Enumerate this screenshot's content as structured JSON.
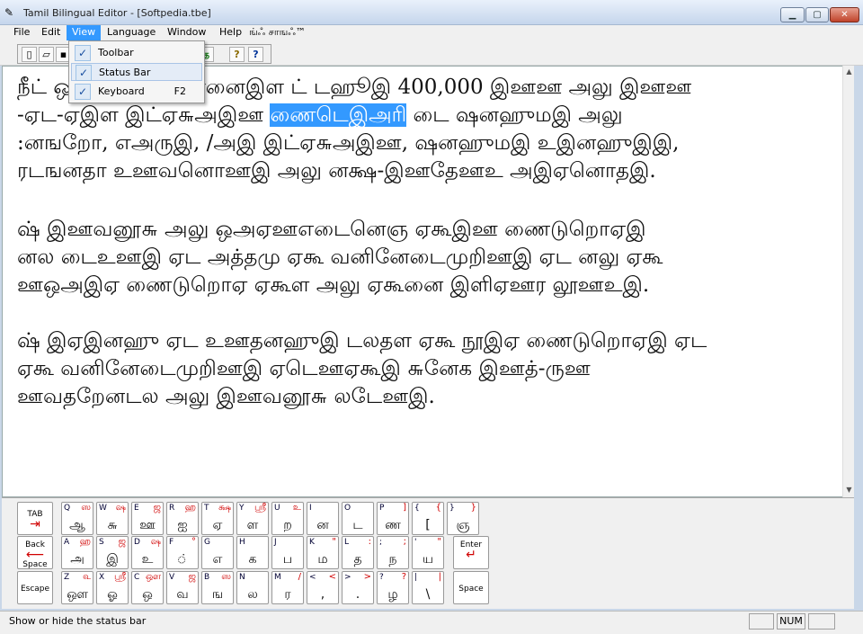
{
  "window": {
    "title": "Tamil Bilingual Editor - [Softpedia.tbe]",
    "app_icon": "pen-icon"
  },
  "menubar": [
    "File",
    "Edit",
    "View",
    "Language",
    "Window",
    "Help",
    "ங்ஃ சாஙஃ™"
  ],
  "toolbar": {
    "buttons": [
      "new-icon",
      "open-icon",
      "save-icon",
      "cut-icon",
      "copy-icon",
      "paste-icon",
      "print-icon",
      "tamil-icon",
      "help-icon",
      "context-help-icon"
    ],
    "tamil_label": "த",
    "help_label": "?",
    "context_help_label": "?"
  },
  "view_menu": {
    "items": [
      {
        "label": "Toolbar",
        "checked": true,
        "shortcut": ""
      },
      {
        "label": "Status Bar",
        "checked": true,
        "shortcut": ""
      },
      {
        "label": "Keyboard",
        "checked": true,
        "shortcut": "F2"
      }
    ]
  },
  "editor": {
    "p1": {
      "line1": "நீட் ஒ ஆ ஊ அ தனனைஇள ட் டஹூஇ 400,000 இஊஊ அலு இஊஊ",
      "line2_pre": "-ஏட-ஏஇள இட்ஏ௬அஇஊ ",
      "line2_sel": "ணைடெஇஅரி",
      "line2_post": " டை ஷனஹுமஇ அலு",
      "line3": ":னஙறோ, எஅருஇ, /அஇ இட்ஏ௬அஇஊ, ஷனஹுமஇ உஇனஹுஇஇ,",
      "line4": "ரடஙனதா உஊவனொஊஇ அலு னக்ஷ-இஊதேஊஉ அஇஏனொதஇ."
    },
    "p2": {
      "line1": "ஷ் இஊவனூ௬ அலு ஒஅஏஊஎடைனெஞ ஏகூஇஊ ணைடுறொஏஇ",
      "line2": "னல டைஉஊஇ ஏட அத்தமு ஏகூ வனினேடைமுறிஊஇ ஏட னலு ஏகூ",
      "line3": "ஊஒஅஇஏ ணைடுறொஏ ஏகூள அலு ஏகூனை இளிஏஊர லூஊஉஇ."
    },
    "p3": {
      "line1": "ஷ் இஏஇனஹு ஏட உஊதனஹுஇ டலதள ஏகூ நூஇஏ ணைடுறொஏஇ ஏட",
      "line2": "ஏகூ வனினேடைமுறிஊஇ ஏடெஊஏகூஇ ௬னேக இஊத்-ருஊ",
      "line3": "ஊவதறேனடல அலு இஊவனூ௬ லடேஊஇ."
    }
  },
  "keyboard": {
    "function_keys": {
      "tab": "TAB",
      "back": "Back",
      "space": "Space",
      "escape": "Escape",
      "enter": "Enter",
      "space2": "Space"
    },
    "row1": [
      {
        "k": "Q",
        "s": "ஸ",
        "m": "ஆ"
      },
      {
        "k": "W",
        "s": "ஷ",
        "m": "௬"
      },
      {
        "k": "E",
        "s": "ஜ",
        "m": "ஊ"
      },
      {
        "k": "R",
        "s": "ஹ",
        "m": "ஐ"
      },
      {
        "k": "T",
        "s": "க்ஷ",
        "m": "ஏ"
      },
      {
        "k": "Y",
        "s": "ஸ்ரீ",
        "m": "ள"
      },
      {
        "k": "U",
        "s": "உ",
        "m": "ற"
      },
      {
        "k": "I",
        "s": "",
        "m": "ன"
      },
      {
        "k": "O",
        "s": "",
        "m": "ட"
      },
      {
        "k": "P",
        "s": "]",
        "m": "ண"
      },
      {
        "k": "{",
        "s": "{",
        "m": "["
      },
      {
        "k": "}",
        "s": "}",
        "m": "ஞ"
      }
    ],
    "row2": [
      {
        "k": "A",
        "s": "ஹ",
        "m": "அ"
      },
      {
        "k": "S",
        "s": "ஜ",
        "m": "இ"
      },
      {
        "k": "D",
        "s": "ஷ",
        "m": "உ"
      },
      {
        "k": "F",
        "s": "°",
        "m": "்"
      },
      {
        "k": "G",
        "s": "",
        "m": "எ"
      },
      {
        "k": "H",
        "s": "",
        "m": "க"
      },
      {
        "k": "J",
        "s": "",
        "m": "ப"
      },
      {
        "k": "K",
        "s": "\"",
        "m": "ம"
      },
      {
        "k": "L",
        "s": ":",
        "m": "த"
      },
      {
        "k": ";",
        "s": ";",
        "m": "ந"
      },
      {
        "k": "'",
        "s": "\"",
        "m": "ய"
      }
    ],
    "row3": [
      {
        "k": "Z",
        "s": "௳",
        "m": "ஔ"
      },
      {
        "k": "X",
        "s": "ஸ்ரீ",
        "m": "ஓ"
      },
      {
        "k": "C",
        "s": "ஔ",
        "m": "ஒ"
      },
      {
        "k": "V",
        "s": "ஜ",
        "m": "வ"
      },
      {
        "k": "B",
        "s": "ஸ",
        "m": "ங"
      },
      {
        "k": "N",
        "s": "",
        "m": "ல"
      },
      {
        "k": "M",
        "s": "/",
        "m": "ர"
      },
      {
        "k": "<",
        "s": "<",
        "m": ","
      },
      {
        "k": ">",
        "s": ">",
        "m": "."
      },
      {
        "k": "?",
        "s": "?",
        "m": "ழ"
      },
      {
        "k": "|",
        "s": "|",
        "m": "\\"
      }
    ]
  },
  "statusbar": {
    "text": "Show or hide the status bar",
    "num": "NUM"
  },
  "colors": {
    "accent": "#3399ff",
    "key_secondary": "#d00000"
  }
}
